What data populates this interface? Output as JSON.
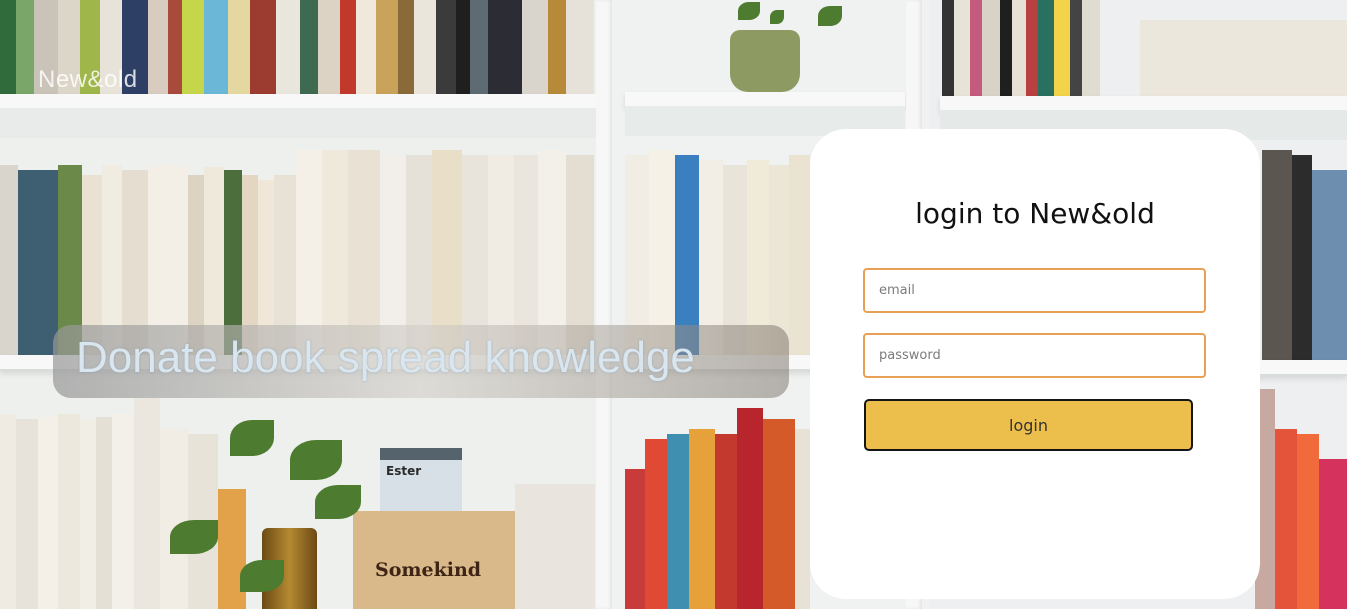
{
  "header": {
    "brand": "New&old"
  },
  "hero": {
    "tagline": "Donate book spread knowledge"
  },
  "background_props": {
    "box_label": "Somekind",
    "book_label": "Ester"
  },
  "login_card": {
    "title": "login to New&old",
    "email_placeholder": "email",
    "password_placeholder": "password",
    "login_label": "login"
  },
  "colors": {
    "field_border": "#e8a154",
    "button_fill": "#ecbe4c",
    "card_bg": "#ffffff"
  }
}
